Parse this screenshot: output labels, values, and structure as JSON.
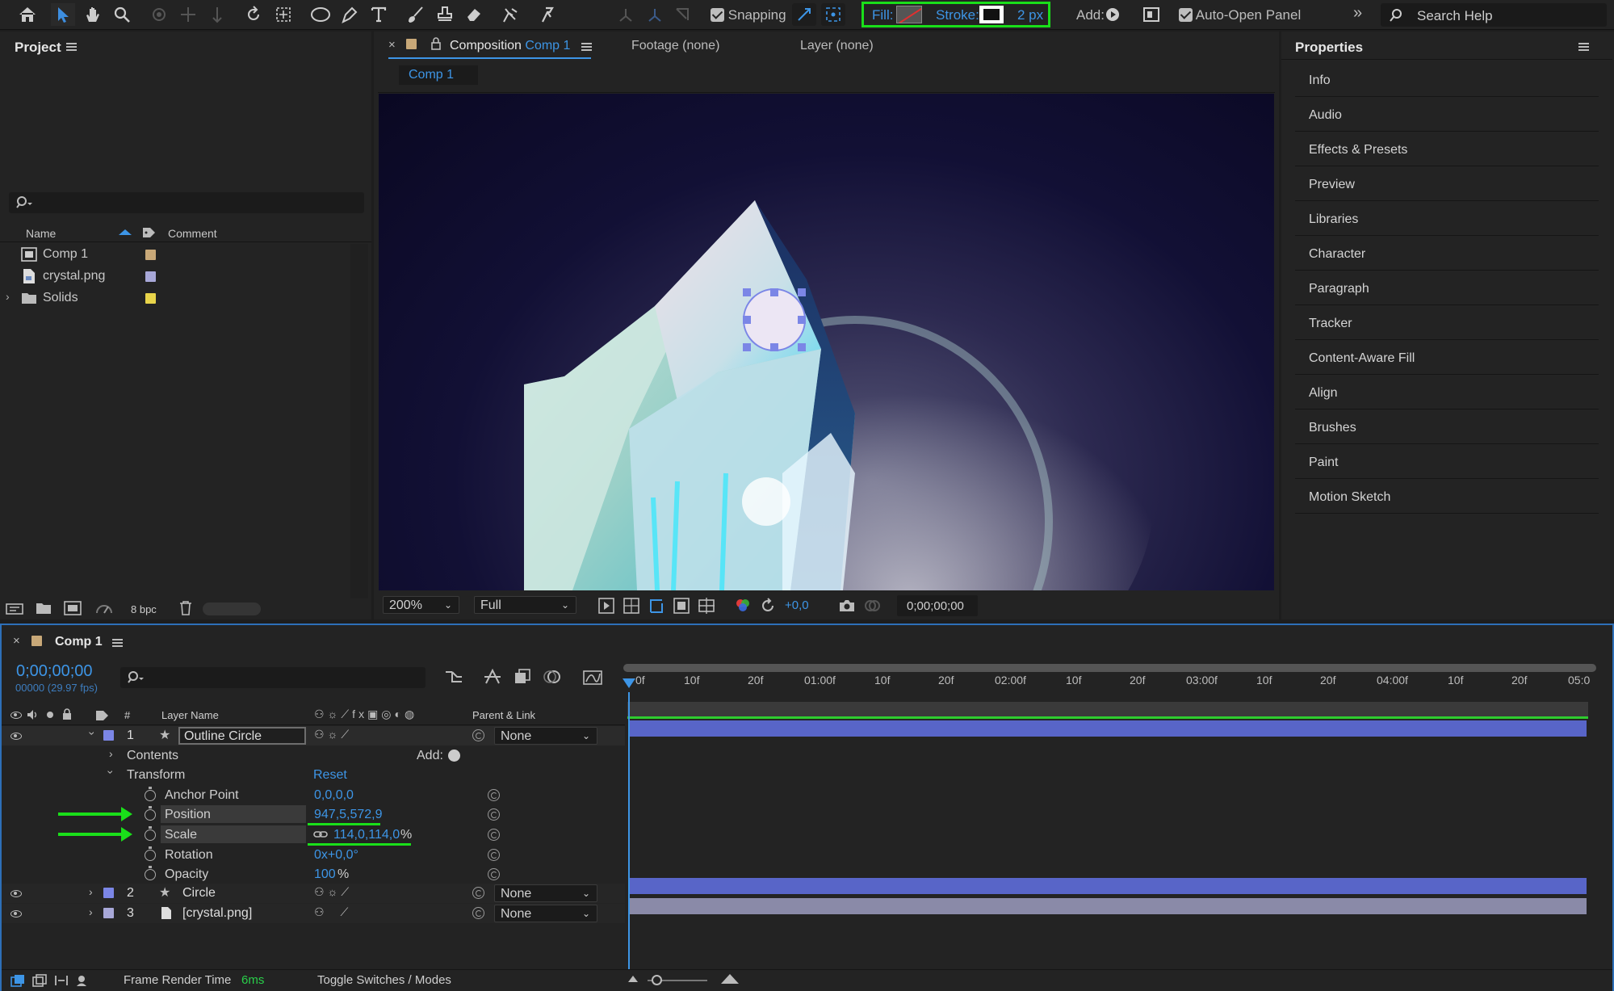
{
  "toolbar": {
    "snapping_label": "Snapping",
    "fill_label": "Fill:",
    "stroke_label": "Stroke:",
    "stroke_width": "2 px",
    "add_label": "Add:",
    "auto_open_label": "Auto-Open Panel",
    "search_placeholder": "Search Help"
  },
  "project": {
    "title": "Project",
    "search_placeholder": "",
    "col_name": "Name",
    "col_comment": "Comment",
    "items": [
      {
        "name": "Comp 1",
        "label_color": "#c8a878"
      },
      {
        "name": "crystal.png",
        "label_color": "#a8a8d8"
      },
      {
        "name": "Solids",
        "label_color": "#e8d44a"
      }
    ],
    "bpc": "8 bpc"
  },
  "composition": {
    "tab_prefix": "Composition",
    "tab_comp": "Comp 1",
    "footage_tab": "Footage (none)",
    "layer_tab": "Layer (none)",
    "breadcrumb": "Comp 1",
    "zoom": "200%",
    "resolution": "Full",
    "exposure": "+0,0",
    "timecode": "0;00;00;00"
  },
  "properties": {
    "title": "Properties",
    "items": [
      "Info",
      "Audio",
      "Effects & Presets",
      "Preview",
      "Libraries",
      "Character",
      "Paragraph",
      "Tracker",
      "Content-Aware Fill",
      "Align",
      "Brushes",
      "Paint",
      "Motion Sketch"
    ]
  },
  "timeline": {
    "tab": "Comp 1",
    "timecode": "0;00;00;00",
    "fps": "00000 (29.97 fps)",
    "col_num": "#",
    "col_layer_name": "Layer Name",
    "col_parent": "Parent & Link",
    "ruler": [
      "0f",
      "10f",
      "20f",
      "01:00f",
      "10f",
      "20f",
      "02:00f",
      "10f",
      "20f",
      "03:00f",
      "10f",
      "20f",
      "04:00f",
      "10f",
      "20f",
      "05:0"
    ],
    "layers": [
      {
        "num": "1",
        "name": "Outline Circle",
        "parent": "None",
        "color": "#7b86e6",
        "bar": "#5865c8"
      },
      {
        "num": "2",
        "name": "Circle",
        "parent": "None",
        "color": "#7b86e6",
        "bar": "#5865c8"
      },
      {
        "num": "3",
        "name": "[crystal.png]",
        "parent": "None",
        "color": "#a8a8d8",
        "bar": "#8a8aa8"
      }
    ],
    "contents_label": "Contents",
    "add_label": "Add:",
    "transform_label": "Transform",
    "reset_label": "Reset",
    "props": [
      {
        "name": "Anchor Point",
        "value": "0,0,0,0"
      },
      {
        "name": "Position",
        "value": "947,5,572,9"
      },
      {
        "name": "Scale",
        "value": "114,0,114,0",
        "unit": "%"
      },
      {
        "name": "Rotation",
        "value": "0x+0,0°"
      },
      {
        "name": "Opacity",
        "value": "100",
        "unit": "%"
      }
    ],
    "render_label": "Frame Render Time",
    "render_value": "6ms",
    "toggle_label": "Toggle Switches / Modes"
  }
}
